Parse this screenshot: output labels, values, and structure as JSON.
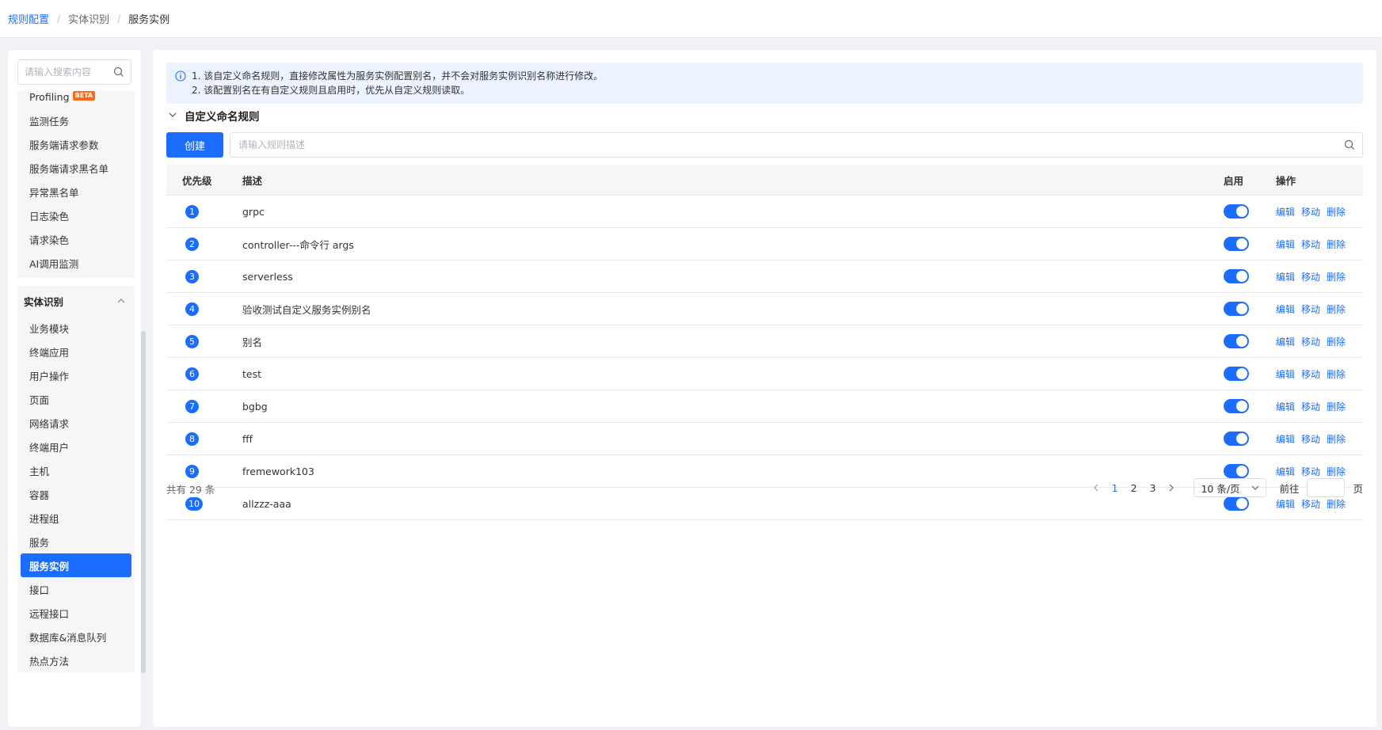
{
  "breadcrumb": [
    "规则配置",
    "实体识别",
    "服务实例"
  ],
  "sidebar": {
    "search_placeholder": "请输入搜索内容",
    "group1_items": [
      {
        "label": "Profiling",
        "badge": "BETA"
      },
      {
        "label": "监测任务"
      },
      {
        "label": "服务端请求参数"
      },
      {
        "label": "服务端请求黑名单"
      },
      {
        "label": "异常黑名单"
      },
      {
        "label": "日志染色"
      },
      {
        "label": "请求染色"
      },
      {
        "label": "AI调用监测"
      }
    ],
    "group2_title": "实体识别",
    "group2_items": [
      "业务模块",
      "终端应用",
      "用户操作",
      "页面",
      "网络请求",
      "终端用户",
      "主机",
      "容器",
      "进程组",
      "服务",
      "服务实例",
      "接口",
      "远程接口",
      "数据库&消息队列",
      "热点方法"
    ],
    "active_item": "服务实例"
  },
  "notice": {
    "line1": "1. 该自定义命名规则，直接修改属性为服务实例配置别名，并不会对服务实例识别名称进行修改。",
    "line2": "2. 该配置别名在有自定义规则且启用时，优先从自定义规则读取。"
  },
  "section_title": "自定义命名规则",
  "create_label": "创建",
  "rule_search_placeholder": "请输入规则描述",
  "table": {
    "headers": {
      "priority": "优先级",
      "desc": "描述",
      "enabled": "启用",
      "ops": "操作"
    },
    "rows": [
      {
        "priority": "1",
        "desc": "grpc",
        "enabled": true
      },
      {
        "priority": "2",
        "desc": "controller---命令行 args",
        "enabled": true
      },
      {
        "priority": "3",
        "desc": "serverless",
        "enabled": true
      },
      {
        "priority": "4",
        "desc": "验收测试自定义服务实例别名",
        "enabled": true
      },
      {
        "priority": "5",
        "desc": "别名",
        "enabled": true
      },
      {
        "priority": "6",
        "desc": "test",
        "enabled": true
      },
      {
        "priority": "7",
        "desc": "bgbg",
        "enabled": true
      },
      {
        "priority": "8",
        "desc": "fff",
        "enabled": true
      },
      {
        "priority": "9",
        "desc": "fremework103",
        "enabled": true
      },
      {
        "priority": "10",
        "desc": "allzzz-aaa",
        "enabled": true
      }
    ],
    "ops": [
      "编辑",
      "移动",
      "删除"
    ]
  },
  "pagination": {
    "total_text": "共有 29 条",
    "pages": [
      "1",
      "2",
      "3"
    ],
    "current": "1",
    "page_size": "10 条/页",
    "goto_label": "前往",
    "page_suffix": "页"
  },
  "colors": {
    "accent": "#1a6dff",
    "beta": "#ff6a1a"
  }
}
